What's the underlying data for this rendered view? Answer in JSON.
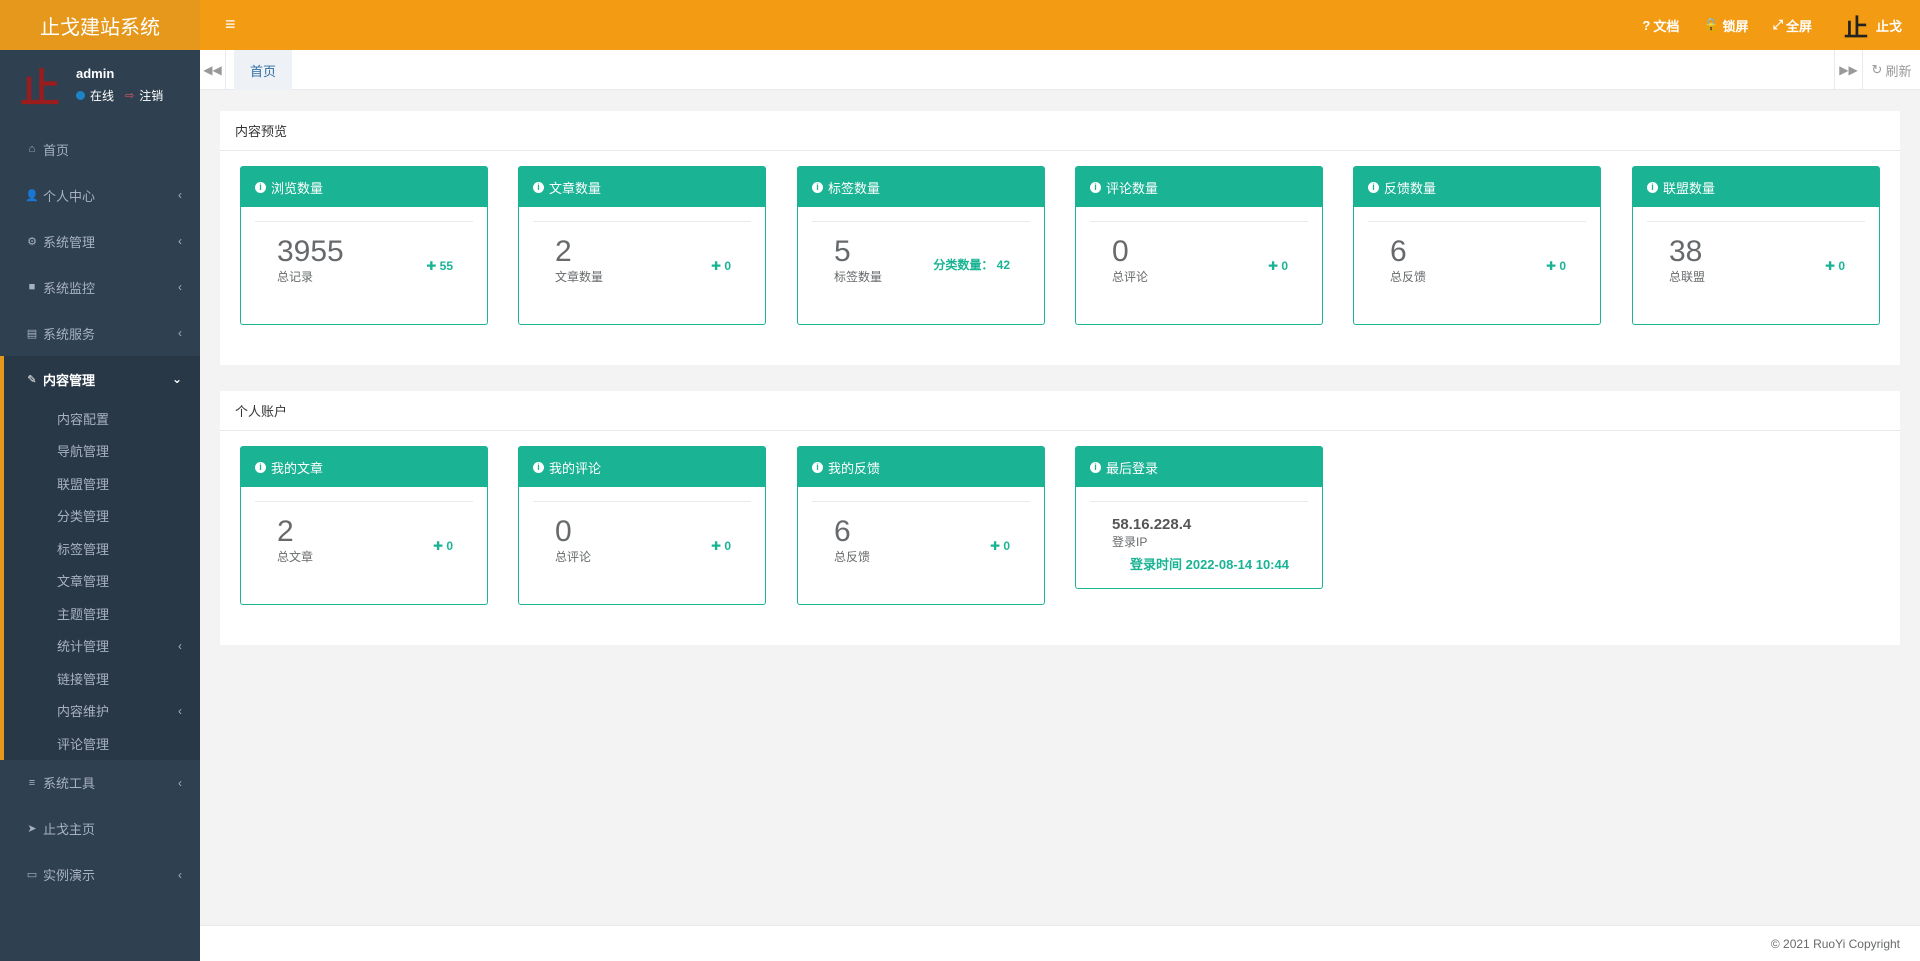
{
  "app": {
    "title": "止戈建站系统"
  },
  "user": {
    "avatar_char": "止",
    "name": "admin",
    "status": "在线",
    "logout": "注销"
  },
  "sidebar": {
    "items": [
      {
        "icon": "home-icon",
        "glyph": "⌂",
        "label": "首页",
        "has_arrow": false
      },
      {
        "icon": "user-icon",
        "glyph": "👤",
        "label": "个人中心",
        "has_arrow": true
      },
      {
        "icon": "gear-icon",
        "glyph": "⚙",
        "label": "系统管理",
        "has_arrow": true
      },
      {
        "icon": "video-icon",
        "glyph": "■",
        "label": "系统监控",
        "has_arrow": true
      },
      {
        "icon": "server-icon",
        "glyph": "▤",
        "label": "系统服务",
        "has_arrow": true
      }
    ],
    "active": {
      "icon": "edit-icon",
      "glyph": "✎",
      "label": "内容管理",
      "arrow": "⌄"
    },
    "sub_items": [
      {
        "label": "内容配置",
        "has_arrow": false
      },
      {
        "label": "导航管理",
        "has_arrow": false
      },
      {
        "label": "联盟管理",
        "has_arrow": false
      },
      {
        "label": "分类管理",
        "has_arrow": false
      },
      {
        "label": "标签管理",
        "has_arrow": false
      },
      {
        "label": "文章管理",
        "has_arrow": false
      },
      {
        "label": "主题管理",
        "has_arrow": false
      },
      {
        "label": "统计管理",
        "has_arrow": true
      },
      {
        "label": "链接管理",
        "has_arrow": false
      },
      {
        "label": "内容维护",
        "has_arrow": true
      },
      {
        "label": "评论管理",
        "has_arrow": false
      }
    ],
    "bottom_items": [
      {
        "icon": "bars-icon",
        "glyph": "≡",
        "label": "系统工具",
        "has_arrow": true
      },
      {
        "icon": "send-icon",
        "glyph": "➤",
        "label": "止戈主页",
        "has_arrow": false
      },
      {
        "icon": "desktop-icon",
        "glyph": "▭",
        "label": "实例演示",
        "has_arrow": true
      }
    ],
    "arrow_glyph": "‹"
  },
  "topbar": {
    "links": [
      {
        "icon": "question-icon",
        "glyph": "?",
        "label": "文档"
      },
      {
        "icon": "lock-icon",
        "glyph": "🔒",
        "label": "锁屏"
      },
      {
        "icon": "fullscreen-icon",
        "glyph": "⤢",
        "label": "全屏"
      }
    ],
    "user_avatar": "止",
    "user_label": "止戈"
  },
  "tabs": {
    "active": "首页",
    "refresh": "刷新"
  },
  "overview": {
    "title": "内容预览",
    "cards": [
      {
        "title": "浏览数量",
        "value": "3955",
        "sub": "总记录",
        "inc": "✚ 55"
      },
      {
        "title": "文章数量",
        "value": "2",
        "sub": "文章数量",
        "inc": "✚ 0"
      },
      {
        "title": "标签数量",
        "value": "5",
        "sub": "标签数量",
        "inc": "分类数量：  42"
      },
      {
        "title": "评论数量",
        "value": "0",
        "sub": "总评论",
        "inc": "✚ 0"
      },
      {
        "title": "反馈数量",
        "value": "6",
        "sub": "总反馈",
        "inc": "✚ 0"
      },
      {
        "title": "联盟数量",
        "value": "38",
        "sub": "总联盟",
        "inc": "✚ 0"
      }
    ]
  },
  "account": {
    "title": "个人账户",
    "cards": [
      {
        "title": "我的文章",
        "value": "2",
        "sub": "总文章",
        "inc": "✚ 0"
      },
      {
        "title": "我的评论",
        "value": "0",
        "sub": "总评论",
        "inc": "✚ 0"
      },
      {
        "title": "我的反馈",
        "value": "6",
        "sub": "总反馈",
        "inc": "✚ 0"
      }
    ],
    "login": {
      "title": "最后登录",
      "ip": "58.16.228.4",
      "ip_label": "登录IP",
      "time": "登录时间 2022-08-14 10:44"
    }
  },
  "footer": {
    "copyright": "© 2021 RuoYi Copyright"
  },
  "colors": {
    "brand": "#f29b13",
    "accent": "#1ab394",
    "sidebar": "#2f4050"
  }
}
